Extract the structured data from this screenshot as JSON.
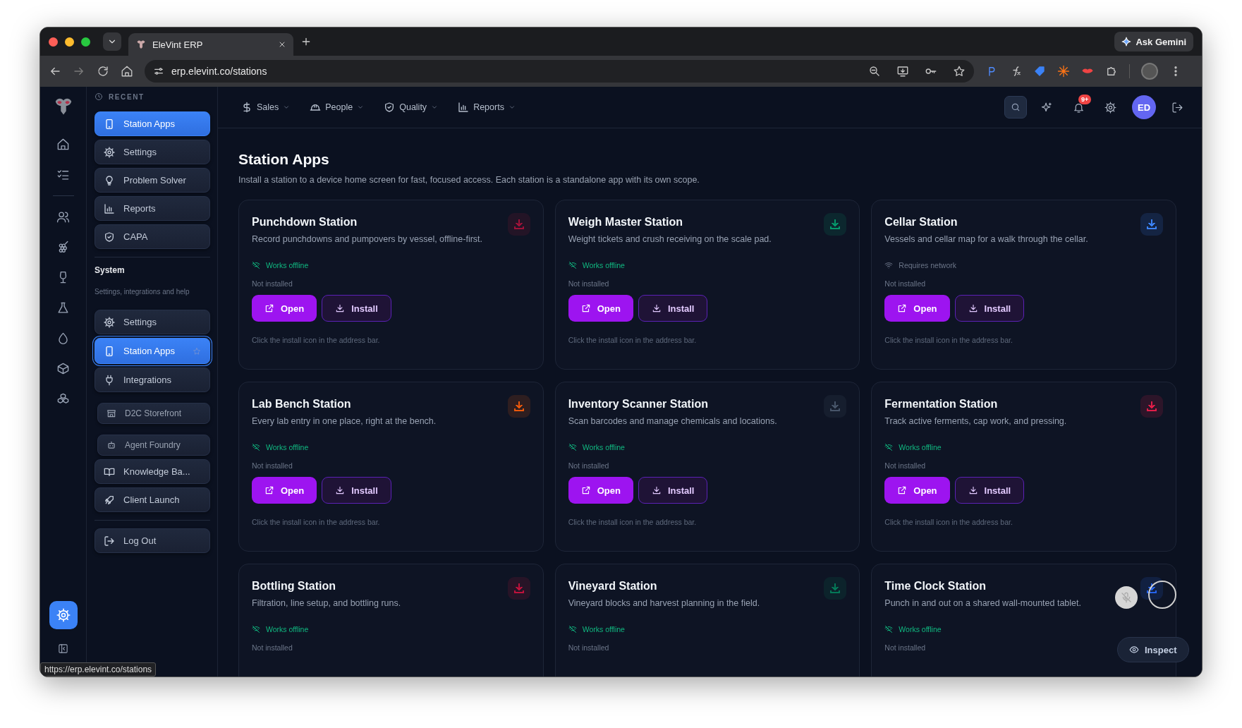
{
  "browser": {
    "tab_title": "EleVint ERP",
    "url": "erp.elevint.co/stations",
    "gemini_button": "Ask Gemini"
  },
  "sidebar": {
    "recent_label": "RECENT",
    "recent": [
      {
        "label": "Station Apps",
        "selected": true
      },
      {
        "label": "Settings",
        "selected": false
      },
      {
        "label": "Problem Solver",
        "selected": false
      },
      {
        "label": "Reports",
        "selected": false
      },
      {
        "label": "CAPA",
        "selected": false
      }
    ],
    "section_title": "System",
    "section_subtitle": "Settings, integrations and help",
    "system": [
      {
        "label": "Settings",
        "selected": false
      },
      {
        "label": "Station Apps",
        "selected": true
      },
      {
        "label": "Integrations",
        "selected": false,
        "children": [
          {
            "label": "D2C Storefront",
            "selected": false
          },
          {
            "label": "Agent Foundry",
            "selected": false
          }
        ]
      },
      {
        "label": "Knowledge Ba...",
        "selected": false
      },
      {
        "label": "Client Launch",
        "selected": false
      }
    ],
    "logout": "Log Out"
  },
  "topnav": {
    "menus": [
      "Sales",
      "People",
      "Quality",
      "Reports"
    ],
    "notifications_badge": "9+",
    "avatar": "ED"
  },
  "page": {
    "title": "Station Apps",
    "subtitle": "Install a station to a device home screen for fast, focused access. Each station is a standalone app with its own scope."
  },
  "cards": [
    {
      "title": "Punchdown Station",
      "description": "Record punchdowns and pumpovers by vessel, offline-first.",
      "color": "#9f1239",
      "status": {
        "kind": "offline",
        "label": "Works offline"
      },
      "install_state": "Not installed",
      "actions": [
        {
          "kind": "open",
          "label": "Open"
        },
        {
          "kind": "install",
          "label": "Install"
        }
      ],
      "hint": "Click the install icon in the address bar."
    },
    {
      "title": "Weigh Master Station",
      "description": "Weight tickets and crush receiving on the scale pad.",
      "color": "#059669",
      "status": {
        "kind": "offline",
        "label": "Works offline"
      },
      "install_state": "Not installed",
      "actions": [
        {
          "kind": "open",
          "label": "Open"
        },
        {
          "kind": "install",
          "label": "Install"
        }
      ],
      "hint": "Click the install icon in the address bar."
    },
    {
      "title": "Cellar Station",
      "description": "Vessels and cellar map for a walk through the cellar.",
      "color": "#3b82f6",
      "status": {
        "kind": "network",
        "label": "Requires network"
      },
      "install_state": "Not installed",
      "actions": [
        {
          "kind": "open",
          "label": "Open"
        },
        {
          "kind": "install",
          "label": "Install"
        }
      ],
      "hint": "Click the install icon in the address bar."
    },
    {
      "title": "Lab Bench Station",
      "description": "Every lab entry in one place, right at the bench.",
      "color": "#ea580c",
      "status": {
        "kind": "offline",
        "label": "Works offline"
      },
      "install_state": "Not installed",
      "actions": [
        {
          "kind": "open",
          "label": "Open"
        },
        {
          "kind": "install",
          "label": "Install"
        }
      ],
      "hint": "Click the install icon in the address bar."
    },
    {
      "title": "Inventory Scanner Station",
      "description": "Scan barcodes and manage chemicals and locations.",
      "color": "#475569",
      "status": {
        "kind": "offline",
        "label": "Works offline"
      },
      "install_state": "Not installed",
      "actions": [
        {
          "kind": "open",
          "label": "Open"
        },
        {
          "kind": "install",
          "label": "Install"
        }
      ],
      "hint": "Click the install icon in the address bar."
    },
    {
      "title": "Fermentation Station",
      "description": "Track active ferments, cap work, and pressing.",
      "color": "#e11d48",
      "status": {
        "kind": "offline",
        "label": "Works offline"
      },
      "install_state": "Not installed",
      "actions": [
        {
          "kind": "open",
          "label": "Open"
        },
        {
          "kind": "install",
          "label": "Install"
        }
      ],
      "hint": "Click the install icon in the address bar."
    },
    {
      "title": "Bottling Station",
      "description": "Filtration, line setup, and bottling runs.",
      "color": "#be123c",
      "status": {
        "kind": "offline",
        "label": "Works offline"
      },
      "install_state": "Not installed"
    },
    {
      "title": "Vineyard Station",
      "description": "Vineyard blocks and harvest planning in the field.",
      "color": "#047857",
      "status": {
        "kind": "offline",
        "label": "Works offline"
      },
      "install_state": "Not installed"
    },
    {
      "title": "Time Clock Station",
      "description": "Punch in and out on a shared wall-mounted tablet.",
      "color": "#2563eb",
      "status": {
        "kind": "offline",
        "label": "Works offline"
      },
      "install_state": "Not installed"
    }
  ],
  "status_url": "https://erp.elevint.co/stations",
  "inspect_button": "Inspect"
}
